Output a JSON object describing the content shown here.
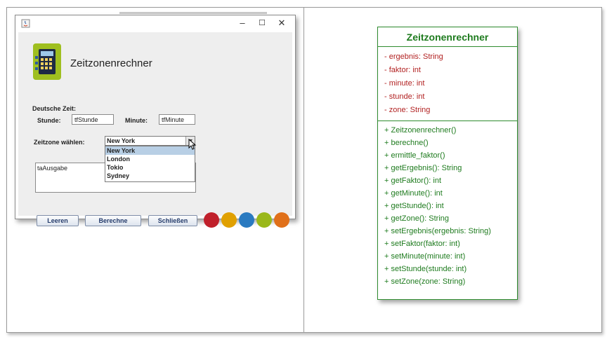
{
  "window": {
    "app_title": "Zeitzonenrechner",
    "controls": {
      "minimize": "–",
      "maximize": "☐",
      "close": "✕"
    },
    "deutsche_zeit_label": "Deutsche Zeit:",
    "stunde_label": "Stunde:",
    "stunde_value": "tfStunde",
    "minute_label": "Minute:",
    "minute_value": "tfMinute",
    "zeitzone_label": "Zeitzone wählen:",
    "combo_selected": "New York",
    "combo_options": [
      "New York",
      "London",
      "Tokio",
      "Sydney"
    ],
    "output_value": "taAusgabe",
    "buttons": {
      "leeren": "Leeren",
      "berechne": "Berechne",
      "schliessen": "Schließen"
    },
    "dot_colors": [
      "#c0202b",
      "#e0a000",
      "#2a7ac0",
      "#9ab81a",
      "#e0701a"
    ]
  },
  "uml": {
    "class_name": "Zeitzonenrechner",
    "attributes": [
      "- ergebnis: String",
      "- faktor: int",
      "- minute: int",
      "- stunde: int",
      "- zone: String"
    ],
    "methods": [
      "+  Zeitzonenrechner()",
      "+  berechne()",
      "+  ermittle_faktor()",
      "+  getErgebnis(): String",
      "+  getFaktor(): int",
      "+  getMinute(): int",
      "+  getStunde(): int",
      "+  getZone(): String",
      "+  setErgebnis(ergebnis: String)",
      "+  setFaktor(faktor: int)",
      "+  setMinute(minute: int)",
      "+  setStunde(stunde: int)",
      "+  setZone(zone: String)"
    ],
    "colors": {
      "border": "#2e8b2e",
      "name": "#1e7b1e",
      "attribute": "#b22222",
      "method": "#1e7b1e"
    }
  }
}
